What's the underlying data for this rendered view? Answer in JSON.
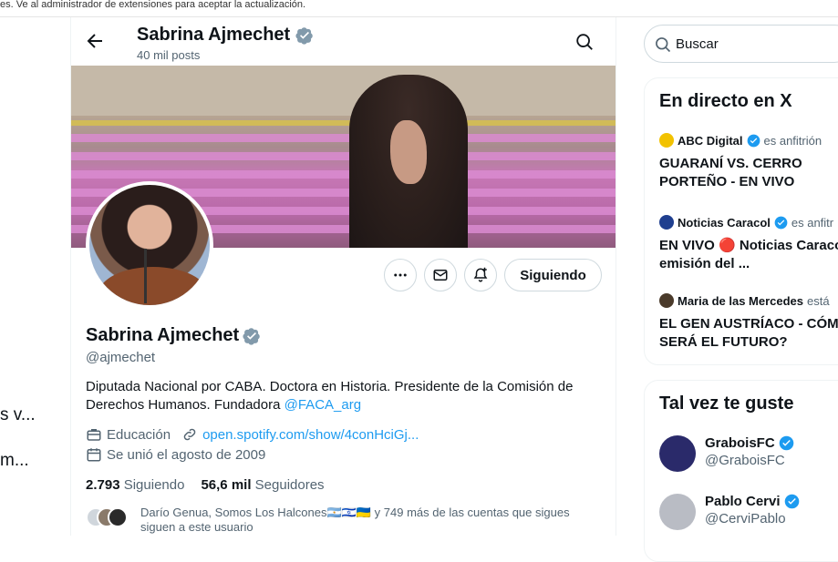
{
  "banner_notice": "es. Ve al administrador de extensiones para aceptar la actualización.",
  "left_fragments": [
    "s v...",
    "m..."
  ],
  "header": {
    "name": "Sabrina Ajmechet",
    "posts": "40 mil posts"
  },
  "profile": {
    "name": "Sabrina Ajmechet",
    "handle": "@ajmechet",
    "bio_text": "Diputada Nacional por CABA. Doctora en Historia. Presidente de la Comisión de Derechos Humanos. Fundadora ",
    "bio_link": "@FACA_arg",
    "category": "Educación",
    "website": "open.spotify.com/show/4conHciGj...",
    "joined": "Se unió el agosto de 2009",
    "following_count": "2.793",
    "following_label": "Siguiendo",
    "followers_count": "56,6 mil",
    "followers_label": "Seguidores",
    "follow_button": "Siguiendo",
    "known_followers": "Darío Genua, Somos Los Halcones🇦🇷🇮🇱🇺🇦 y 749 más de las cuentas que sigues siguen a este usuario"
  },
  "search": {
    "placeholder": "Buscar"
  },
  "live": {
    "title": "En directo en X",
    "items": [
      {
        "source": "ABC Digital",
        "host": "es anfitrión",
        "headline": "GUARANÍ VS. CERRO PORTEÑO - EN VIVO",
        "icon_color": "#f2c200"
      },
      {
        "source": "Noticias Caracol",
        "host": "es anfitr",
        "headline": "EN VIVO 🔴 Noticias Caracol - emisión del ...",
        "icon_color": "#1f3f8f"
      },
      {
        "source": "Maria de las Mercedes",
        "host": "está",
        "headline": "EL GEN AUSTRÍACO - CÓMO SERÁ EL FUTURO?",
        "icon_color": "#4a3a2a"
      }
    ]
  },
  "suggest": {
    "title": "Tal vez te guste",
    "items": [
      {
        "name": "GraboisFC",
        "handle": "@GraboisFC",
        "avatar_color": "#2a2a6a"
      },
      {
        "name": "Pablo Cervi",
        "handle": "@CerviPablo",
        "avatar_color": "#b9bcc4"
      }
    ]
  },
  "colors": {
    "accent": "#1d9bf0",
    "muted": "#536471",
    "verified": "#1d9bf0",
    "verified_gray": "#829aab"
  }
}
